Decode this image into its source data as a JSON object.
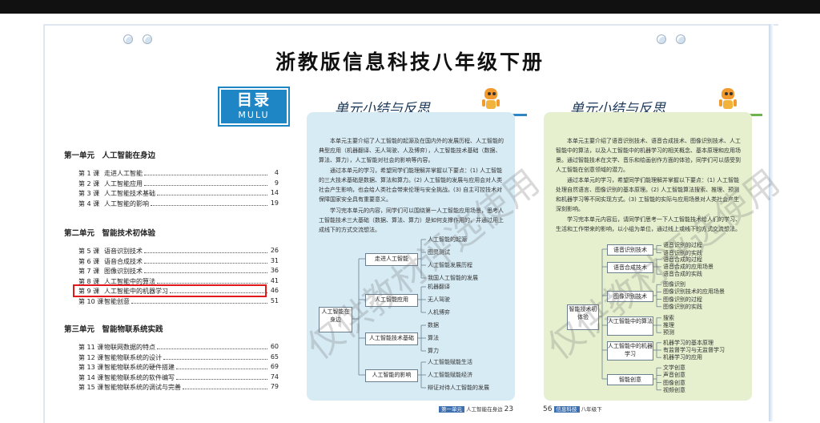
{
  "page_title": "浙教版信息科技八年级下册",
  "toc": {
    "badge_cn": "目录",
    "badge_en": "MULU",
    "units": [
      {
        "title": "第一单元　人工智能在身边",
        "lessons": [
          {
            "no": "第 1 课",
            "name": "走进人工智能",
            "page": "4"
          },
          {
            "no": "第 2 课",
            "name": "人工智能应用",
            "page": "9"
          },
          {
            "no": "第 3 课",
            "name": "人工智能技术基础",
            "page": "14"
          },
          {
            "no": "第 4 课",
            "name": "人工智能的影响",
            "page": "19"
          }
        ]
      },
      {
        "title": "第二单元　智能技术初体验",
        "lessons": [
          {
            "no": "第 5 课",
            "name": "语音识别技术",
            "page": "26"
          },
          {
            "no": "第 6 课",
            "name": "语音合成技术",
            "page": "31"
          },
          {
            "no": "第 7 课",
            "name": "图像识别技术",
            "page": "36"
          },
          {
            "no": "第 8 课",
            "name": "人工智能中的算法",
            "page": "41"
          },
          {
            "no": "第 9 课",
            "name": "人工智能中的机器学习",
            "page": "46"
          },
          {
            "no": "第 10 课",
            "name": "智能创意",
            "page": "51"
          }
        ]
      },
      {
        "title": "第三单元　智能物联系统实践",
        "lessons": [
          {
            "no": "第 11 课",
            "name": "物联网数据的特点",
            "page": "60"
          },
          {
            "no": "第 12 课",
            "name": "智能物联系统的设计",
            "page": "65"
          },
          {
            "no": "第 13 课",
            "name": "智能物联系统的硬件搭建",
            "page": "69"
          },
          {
            "no": "第 14 课",
            "name": "智能物联系统的软件编写",
            "page": "74"
          },
          {
            "no": "第 15 课",
            "name": "智能物联系统的调试与完善",
            "page": "79"
          }
        ]
      }
    ]
  },
  "summary_blue": {
    "title": "单元小结与反思",
    "paras": [
      "本单元主要介绍了人工智能的起源及在国内外的发展历程、人工智能的典型应用（机器翻译、无人驾驶、人及博弈），人工智能技术基础（数据、算法、算力），人工智能对社会的影响等内容。",
      "通过本单元的学习，希望同学们能理解并掌握以下要点：(1) 人工智能的三大技术基础是数据、算法和算力。(2) 人工智能的发展与应用会对人类社会产生影响，也会给人类社会带来伦理与安全挑战。(3) 自主可控技术对保障国家安全具有重要意义。",
      "学习完本单元的内容，同学们可以围绕第一人工智能应用场景，思考人工智能技术三大基础（数据、算法、算力）是如何支撑作用的，并通过用上成线下的方式交流想法。"
    ],
    "root": "人工智能在身边",
    "branches": [
      {
        "name": "走进人工智能",
        "leaves": [
          "人工智能的起源",
          "图灵测试",
          "人工智能发展历程",
          "我国人工智能的发展"
        ]
      },
      {
        "name": "人工智能应用",
        "leaves": [
          "机器翻译",
          "无人驾驶",
          "人机博弈"
        ]
      },
      {
        "name": "人工智能技术基础",
        "leaves": [
          "数据",
          "算法",
          "算力"
        ]
      },
      {
        "name": "人工智能的影响",
        "leaves": [
          "人工智能赋能生活",
          "人工智能赋能经济",
          "辩证对待人工智能的发展"
        ]
      }
    ],
    "footer_unit": "第一单元",
    "footer_text": "人工智能在身边",
    "footer_page": "23"
  },
  "summary_green": {
    "title": "单元小结与反思",
    "paras": [
      "本单元主要介绍了语音识别技术、语音合成技术、图像识别技术、人工智能中的算法，以及人工智能中的机器学习的相关概念、基本原理和应用场景。通过智能技术在文学、音乐和绘画创作方面的体验，同学们可以感受到人工智能在创意领域的潜力。",
      "通过本单元的学习，希望同学们能理解并掌握以下要点：(1) 人工智能处理自然语言、图像识别的基本原理。(2) 人工智能算法搜索、推理、预测和机器学习等不同实现方式。(3) 工智能的实际与应用场景对人类社会产生深刻影响。",
      "学习完本单元内容后，请同学们思考一下人工智能技术给人们的学习、生活和工作带来的影响，以小组为单位，通过线上或线下的方式交流想法。"
    ],
    "root": "智能技术初体验",
    "branches": [
      {
        "name": "语音识别技术",
        "leaves": [
          "语音识别的过程",
          "语音识别的实践"
        ]
      },
      {
        "name": "语音合成技术",
        "leaves": [
          "语音合成的过程",
          "语音合成的应用场景",
          "语音合成的实践"
        ]
      },
      {
        "name": "图像识别技术",
        "leaves": [
          "图像识别",
          "图像识别技术的应用场景",
          "图像识别的过程",
          "图像识别的实践"
        ]
      },
      {
        "name": "人工智能中的算法",
        "leaves": [
          "搜索",
          "推理",
          "预测"
        ]
      },
      {
        "name": "人工智能中的机器学习",
        "leaves": [
          "机器学习的基本原理",
          "有监督学习与无监督学习",
          "机器学习的应用"
        ]
      },
      {
        "name": "智能创意",
        "leaves": [
          "文学创意",
          "声音创意",
          "图像创意",
          "视频创意"
        ]
      }
    ],
    "footer_page": "56",
    "footer_book": "信息科技",
    "footer_grade": "八年级下"
  },
  "watermark": "仅供教材评选使用",
  "colors": {
    "badge": "#1f86c6",
    "highlight": "#e0191b",
    "blue_panel": "#d7ebf5",
    "green_panel": "#e6f0cf",
    "blue_title_line": "#2f86c7",
    "green_title_line": "#6db54a"
  }
}
